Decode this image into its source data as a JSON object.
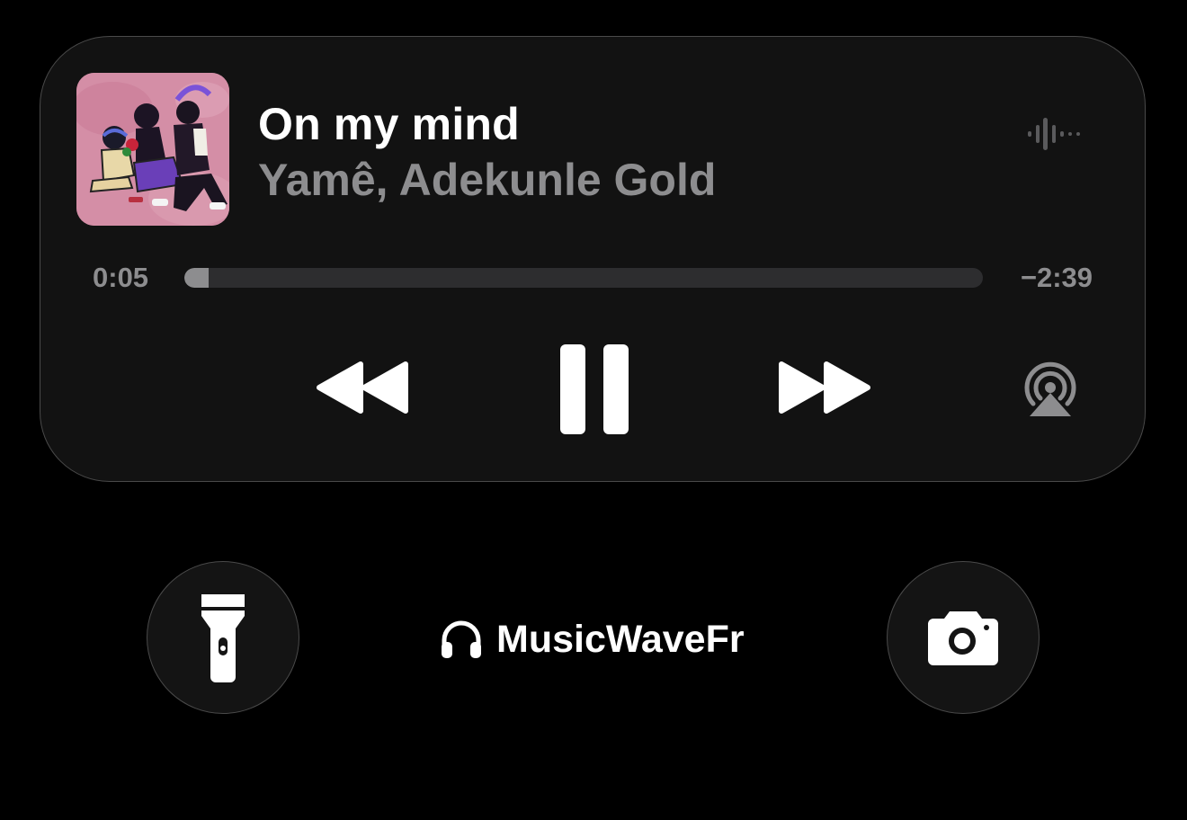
{
  "now_playing": {
    "title": "On my mind",
    "artist": "Yamê, Adekunle Gold",
    "elapsed": "0:05",
    "remaining": "−2:39",
    "progress_fraction": 0.03
  },
  "controls": {
    "rewind_icon": "backward-icon",
    "pause_icon": "pause-icon",
    "forward_icon": "forward-icon",
    "airplay_icon": "airplay-audio-icon",
    "waveform_icon": "audio-waveform-icon"
  },
  "lock_screen": {
    "flashlight_icon": "flashlight-icon",
    "camera_icon": "camera-icon",
    "device_icon": "headphones-icon",
    "device_name": "MusicWaveFr"
  },
  "colors": {
    "background": "#000000",
    "panel": "#121212",
    "secondary_text": "#8d8d8f",
    "track_bg": "#2d2d2f"
  }
}
